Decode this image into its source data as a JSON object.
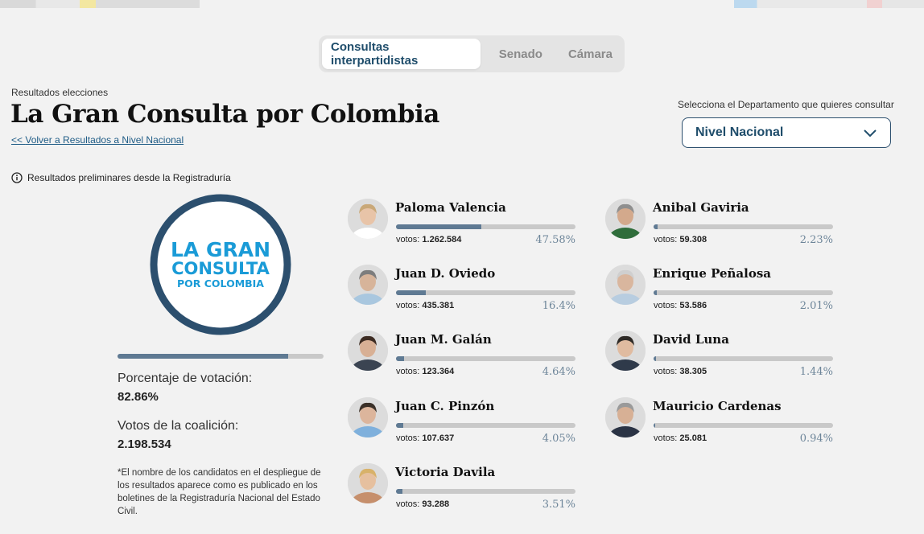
{
  "tabs": [
    {
      "label": "Consultas interpartidistas",
      "active": true
    },
    {
      "label": "Senado",
      "active": false
    },
    {
      "label": "Cámara",
      "active": false
    }
  ],
  "header": {
    "eyebrow": "Resultados elecciones",
    "title": "La Gran Consulta por Colombia",
    "back_link": "Volver a Resultados a Nivel Nacional",
    "back_chevrons": "<<"
  },
  "department": {
    "label": "Selecciona el Departamento que quieres consultar",
    "selected": "Nivel Nacional"
  },
  "notice": "Resultados preliminares desde la Registraduría",
  "logo": {
    "line1": "LA GRAN",
    "line2": "CONSULTA",
    "line3": "POR COLOMBIA",
    "ring_color": "#2c4f6e",
    "text_color": "#1a9bd7"
  },
  "coalition": {
    "participation_label": "Porcentaje de votación:",
    "participation_value": "82.86%",
    "participation_fraction": 0.8286,
    "votes_label": "Votos de la coalición:",
    "votes_value": "2.198.534",
    "footnote": "*El nombre de los candidatos en el despliegue de los resultados aparece como es publicado en los boletines de la Registraduría Nacional del Estado Civil."
  },
  "votes_prefix": "votos:",
  "candidates": [
    {
      "name": "Paloma Valencia",
      "votes": "1.262.584",
      "percent": "47.58%",
      "fraction": 0.4758,
      "skin": "#e8c4a8",
      "hair": "#c9a878",
      "shirt": "#ffffff"
    },
    {
      "name": "Juan D. Oviedo",
      "votes": "435.381",
      "percent": "16.4%",
      "fraction": 0.164,
      "skin": "#d7b49a",
      "hair": "#7d7d7d",
      "shirt": "#a9c7df"
    },
    {
      "name": "Juan M. Galán",
      "votes": "123.364",
      "percent": "4.64%",
      "fraction": 0.0464,
      "skin": "#d8b095",
      "hair": "#3c2b22",
      "shirt": "#3b4452"
    },
    {
      "name": "Juan C. Pinzón",
      "votes": "107.637",
      "percent": "4.05%",
      "fraction": 0.0405,
      "skin": "#dcb59c",
      "hair": "#3a3028",
      "shirt": "#7fb0dc"
    },
    {
      "name": "Victoria Davila",
      "votes": "93.288",
      "percent": "3.51%",
      "fraction": 0.0351,
      "skin": "#e6c09f",
      "hair": "#d8b26a",
      "shirt": "#c68f6c"
    },
    {
      "name": "Anibal Gaviria",
      "votes": "59.308",
      "percent": "2.23%",
      "fraction": 0.0223,
      "skin": "#d3a98c",
      "hair": "#8f8f8f",
      "shirt": "#2f6d3b"
    },
    {
      "name": "Enrique Peñalosa",
      "votes": "53.586",
      "percent": "2.01%",
      "fraction": 0.0201,
      "skin": "#d9b69e",
      "hair": "#cfcfcf",
      "shirt": "#b8cde0"
    },
    {
      "name": "David Luna",
      "votes": "38.305",
      "percent": "1.44%",
      "fraction": 0.0144,
      "skin": "#e0bba0",
      "hair": "#2e2a26",
      "shirt": "#2f3a4a"
    },
    {
      "name": "Mauricio Cardenas",
      "votes": "25.081",
      "percent": "0.94%",
      "fraction": 0.0094,
      "skin": "#d7b095",
      "hair": "#9a9a9a",
      "shirt": "#2a3344"
    }
  ]
}
